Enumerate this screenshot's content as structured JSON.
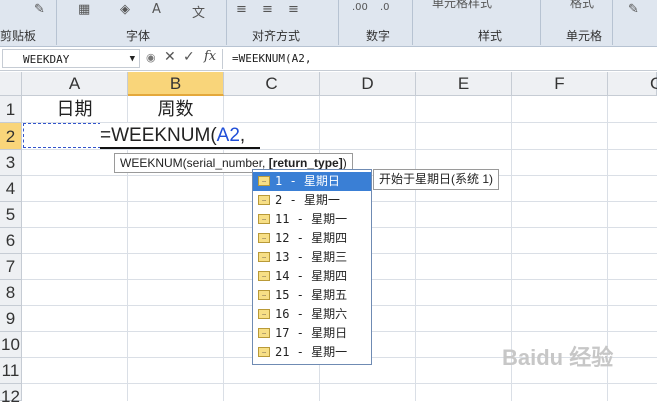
{
  "ribbon": {
    "groups": [
      "剪贴板",
      "字体",
      "对齐方式",
      "数字",
      "样式",
      "单元格"
    ],
    "partial_labels": [
      "单元格样式",
      "格式"
    ]
  },
  "formula_bar": {
    "name_box": "WEEKDAY",
    "formula": "=WEEKNUM(A2,"
  },
  "columns": [
    "A",
    "B",
    "C",
    "D",
    "E",
    "F",
    "G"
  ],
  "rows": [
    "1",
    "2",
    "3",
    "4",
    "5",
    "6",
    "7",
    "8",
    "9",
    "10",
    "11",
    "12"
  ],
  "cells": {
    "A1": "日期",
    "B1": "周数",
    "B2_prefix": "=WEEKNUM(",
    "B2_ref": "A2",
    "B2_suffix": ","
  },
  "arg_tooltip": {
    "func": "WEEKNUM(serial_number, ",
    "bold_arg": "[return_type]",
    "close": ")"
  },
  "autocomplete": {
    "items": [
      "1 - 星期日",
      "2 - 星期一",
      "11 - 星期一",
      "12 - 星期四",
      "13 - 星期三",
      "14 - 星期四",
      "15 - 星期五",
      "16 - 星期六",
      "17 - 星期日",
      "21 - 星期一"
    ],
    "selected_index": 0,
    "description": "开始于星期日(系统 1)"
  },
  "watermark": "Baidu 经验",
  "colors": {
    "accent": "#3a7fd5",
    "header_active": "#f9d57a",
    "ref_blue": "#1f4ed8"
  }
}
